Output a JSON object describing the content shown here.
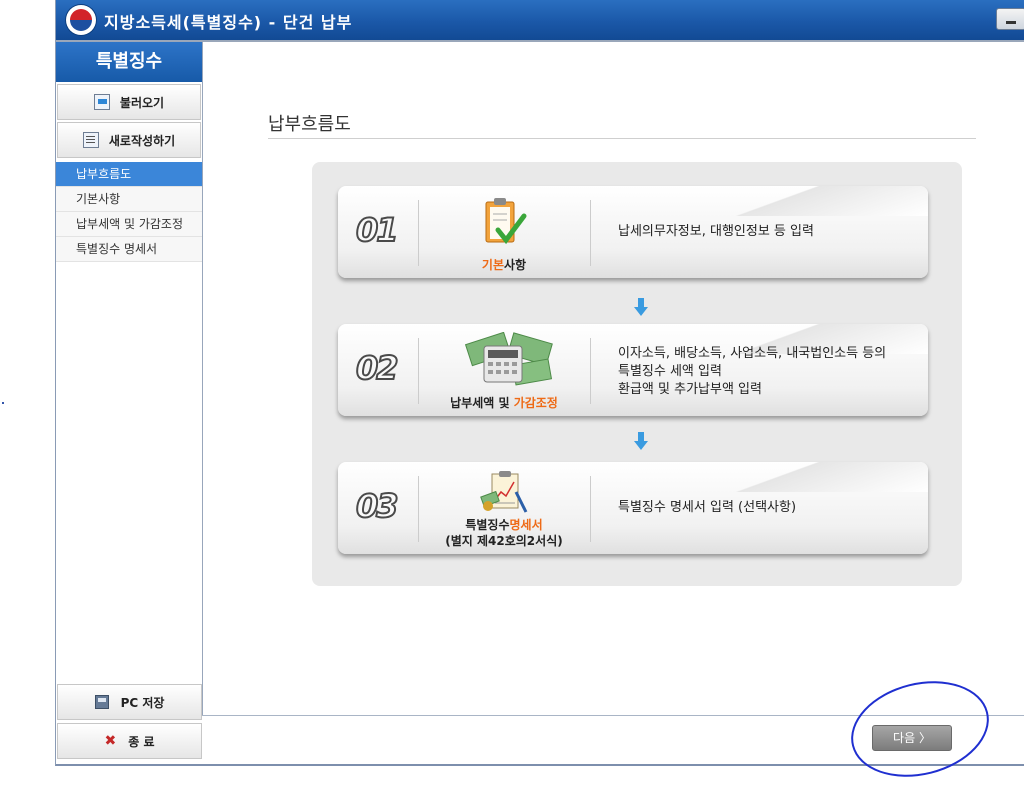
{
  "window": {
    "title": "지방소득세(특별징수) - 단건 납부"
  },
  "sidebar": {
    "header": "특별징수",
    "load_button": "불러오기",
    "new_button": "새로작성하기",
    "menu": [
      {
        "label": "납부흐름도",
        "active": true
      },
      {
        "label": "기본사항",
        "active": false
      },
      {
        "label": "납부세액 및 가감조정",
        "active": false
      },
      {
        "label": "특별징수 명세서",
        "active": false
      }
    ],
    "save_button": "PC 저장",
    "exit_button": "종 료"
  },
  "main": {
    "section_title": "납부흐름도",
    "steps": [
      {
        "num": "01",
        "label_a": "기본",
        "label_b": "사항",
        "label_c": "",
        "icon": "clipboard-check-icon",
        "desc": [
          "납세의무자정보, 대행인정보 등 입력"
        ]
      },
      {
        "num": "02",
        "label_a": "납부세액 및 ",
        "label_b": "가감조정",
        "label_c": "",
        "icon": "calculator-money-icon",
        "desc": [
          "이자소득, 배당소득, 사업소득, 내국법인소득 등의",
          "특별징수 세액 입력",
          "환급액 및 추가납부액 입력"
        ]
      },
      {
        "num": "03",
        "label_a": "특별징수",
        "label_b": "명세서",
        "label_c": "(별지 제42호의2서식)",
        "icon": "chart-document-icon",
        "desc": [
          "특별징수 명세서 입력 (선택사항)"
        ]
      }
    ]
  },
  "footer": {
    "next_button": "다음 〉"
  },
  "colors": {
    "title_blue": "#1b58a8",
    "accent_orange": "#ee6a16",
    "active_menu": "#3b86d9",
    "annotation": "#1f2fd0"
  }
}
